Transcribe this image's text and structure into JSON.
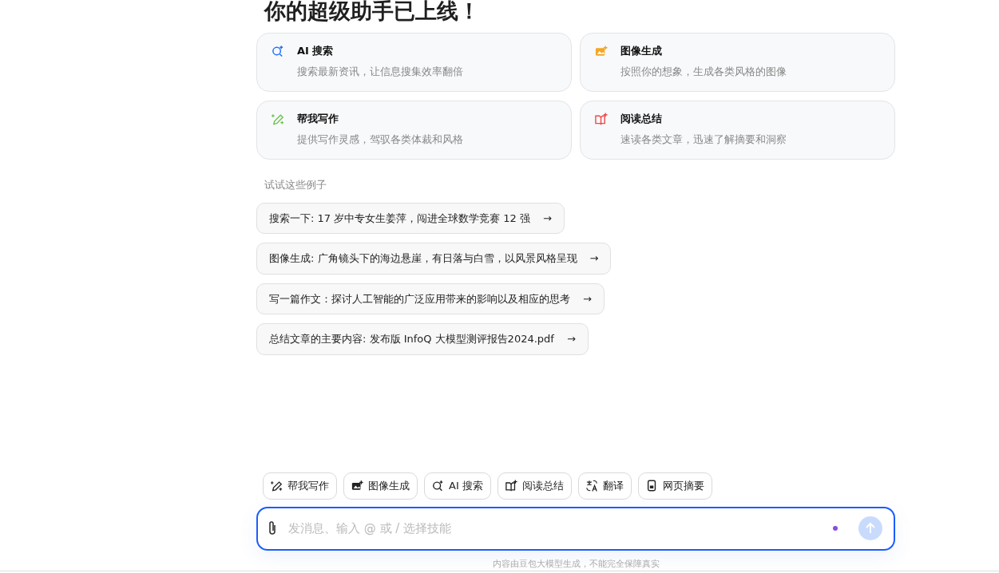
{
  "title": "你的超级助手已上线！",
  "features": [
    {
      "kind": "search",
      "title": "AI 搜索",
      "desc": "搜索最新资讯，让信息搜集效率翻倍"
    },
    {
      "kind": "image",
      "title": "图像生成",
      "desc": "按照你的想象，生成各类风格的图像"
    },
    {
      "kind": "write",
      "title": "帮我写作",
      "desc": "提供写作灵感，驾驭各类体裁和风格"
    },
    {
      "kind": "read",
      "title": "阅读总结",
      "desc": "速读各类文章，迅速了解摘要和洞察"
    }
  ],
  "examples_label": "试试这些例子",
  "examples": [
    {
      "text": "搜索一下: 17 岁中专女生姜萍，闯进全球数学竞赛 12 强",
      "arrow": "→"
    },
    {
      "text": "图像生成: 广角镜头下的海边悬崖，有日落与白雪，以风景风格呈现",
      "arrow": "→"
    },
    {
      "text": "写一篇作文：探讨人工智能的广泛应用带来的影响以及相应的思考",
      "arrow": "→"
    },
    {
      "text": "总结文章的主要内容: 发布版 InfoQ 大模型测评报告2024.pdf",
      "arrow": "→"
    }
  ],
  "skills": [
    {
      "kind": "write",
      "label": "帮我写作"
    },
    {
      "kind": "image",
      "label": "图像生成"
    },
    {
      "kind": "search",
      "label": "AI 搜索"
    },
    {
      "kind": "read",
      "label": "阅读总结"
    },
    {
      "kind": "translate",
      "label": "翻译"
    },
    {
      "kind": "webpage",
      "label": "网页摘要"
    }
  ],
  "input": {
    "placeholder": "发消息、输入 @ 或 / 选择技能",
    "send_enabled": false
  },
  "footer": "内容由豆包大模型生成，不能完全保障真实"
}
